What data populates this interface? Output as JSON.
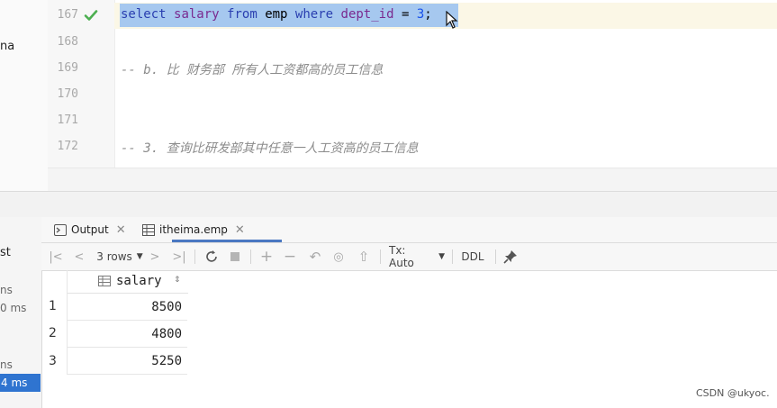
{
  "left_edge": {
    "label": "na"
  },
  "editor": {
    "lines": [
      {
        "number": "167",
        "code": [
          {
            "text": "select",
            "cls": "kw"
          },
          {
            "text": " ",
            "cls": ""
          },
          {
            "text": "salary",
            "cls": "id"
          },
          {
            "text": " ",
            "cls": ""
          },
          {
            "text": "from",
            "cls": "kw"
          },
          {
            "text": " ",
            "cls": ""
          },
          {
            "text": "emp",
            "cls": ""
          },
          {
            "text": " ",
            "cls": ""
          },
          {
            "text": "where",
            "cls": "kw"
          },
          {
            "text": " ",
            "cls": ""
          },
          {
            "text": "dept_id",
            "cls": "id"
          },
          {
            "text": " = ",
            "cls": ""
          },
          {
            "text": "3",
            "cls": "num"
          },
          {
            "text": ";",
            "cls": ""
          }
        ]
      },
      {
        "number": "168",
        "code": []
      },
      {
        "number": "169",
        "code": [
          {
            "text": "-- b. 比 财务部 所有人工资都高的员工信息",
            "cls": "cmt"
          }
        ]
      },
      {
        "number": "170",
        "code": []
      },
      {
        "number": "171",
        "code": []
      },
      {
        "number": "172",
        "code": [
          {
            "text": "-- 3. 查询比研发部其中任意一人工资高的员工信息",
            "cls": "cmt"
          }
        ]
      }
    ]
  },
  "left_panel": {
    "items": [
      "st",
      "ns",
      "0 ms",
      "ns",
      "4 ms"
    ]
  },
  "tabs": {
    "output": "Output",
    "emp": "itheima.emp"
  },
  "toolbar": {
    "rows_label": "3 rows",
    "tx_label": "Tx: Auto",
    "ddl_label": "DDL"
  },
  "grid": {
    "column": "salary",
    "rows": [
      {
        "num": "1",
        "value": "8500"
      },
      {
        "num": "2",
        "value": "4800"
      },
      {
        "num": "3",
        "value": "5250"
      }
    ]
  },
  "watermark": "CSDN @ukyoc.",
  "colors": {
    "selection": "#a6c8ef",
    "accent": "#2f74d0",
    "check": "#4caf50"
  }
}
